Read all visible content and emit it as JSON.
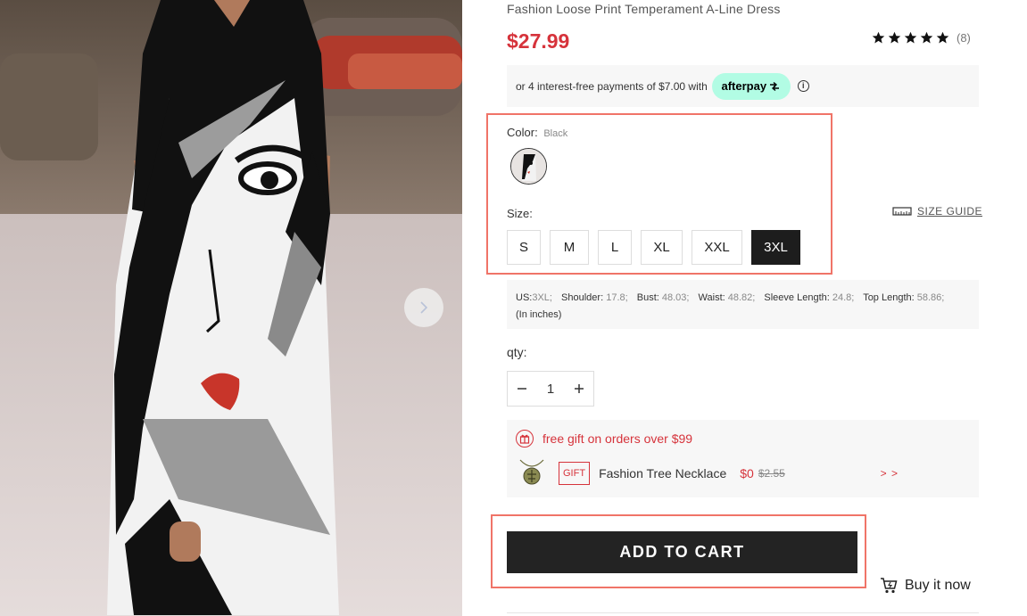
{
  "product": {
    "title": "Fashion Loose Print Temperament A-Line Dress",
    "price": "$27.99",
    "rating": {
      "stars": 5,
      "review_count": "(8)"
    }
  },
  "afterpay": {
    "text": "or 4 interest-free payments of $7.00 with",
    "brand": "afterpay",
    "brand_icon": "afterpay-arrow-icon",
    "info_icon": "info-icon"
  },
  "color": {
    "label": "Color:",
    "selected": "Black"
  },
  "size": {
    "label": "Size:",
    "guide_label": "SIZE GUIDE",
    "options": [
      "S",
      "M",
      "L",
      "XL",
      "XXL",
      "3XL"
    ],
    "selected": "3XL"
  },
  "measurements": {
    "items": [
      {
        "key": "US:",
        "value": "3XL;"
      },
      {
        "key": "Shoulder:",
        "value": "17.8;"
      },
      {
        "key": "Bust:",
        "value": "48.03;"
      },
      {
        "key": "Waist:",
        "value": "48.82;"
      },
      {
        "key": "Sleeve Length:",
        "value": "24.8;"
      },
      {
        "key": "Top Length:",
        "value": "58.86;"
      }
    ],
    "unit_note": "(In inches)"
  },
  "quantity": {
    "label": "qty:",
    "value": "1",
    "decrement": "−",
    "increment": "+"
  },
  "gift": {
    "header": "free gift on orders over $99",
    "tag": "GIFT",
    "name": "Fashion Tree Necklace",
    "price": "$0",
    "original_price": "$2.55",
    "more": "> >"
  },
  "actions": {
    "add_to_cart": "ADD TO CART",
    "buy_now": "Buy it now"
  },
  "colors": {
    "price_red": "#d6333b",
    "afterpay_mint": "#b2fce4",
    "highlight": "#f07468",
    "button_dark": "#232323"
  }
}
